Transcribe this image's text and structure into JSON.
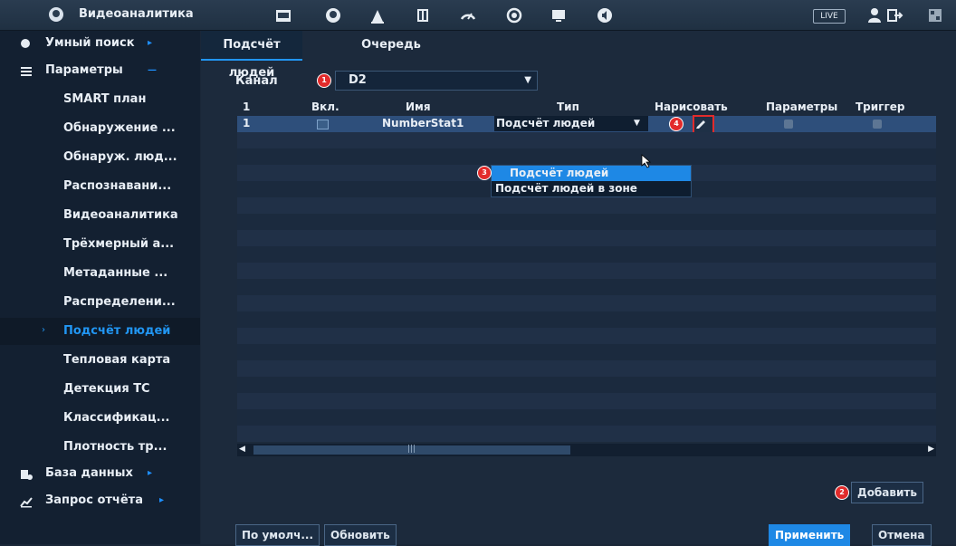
{
  "header": {
    "title": "Видеоаналитика",
    "live_label": "LIVE",
    "icons": [
      "face-icon",
      "film-icon",
      "face-icon",
      "alarm-icon",
      "storage-icon",
      "speed-icon",
      "record-icon",
      "monitor-icon",
      "audio-icon",
      "user-icon",
      "logout-icon",
      "qr-icon"
    ]
  },
  "sidebar": {
    "top": [
      {
        "label": "Умный поиск",
        "icon": "face-search-icon"
      },
      {
        "label": "Параметры",
        "icon": "list-icon"
      },
      {
        "label": "База данных",
        "icon": "database-icon"
      },
      {
        "label": "Запрос отчёта",
        "icon": "chart-icon"
      }
    ],
    "items": [
      {
        "label": "SMART план"
      },
      {
        "label": "Обнаружение ..."
      },
      {
        "label": "Обнаруж. люд..."
      },
      {
        "label": "Распознавани..."
      },
      {
        "label": "Видеоаналитика"
      },
      {
        "label": "Трёхмерный а..."
      },
      {
        "label": "Метаданные ..."
      },
      {
        "label": "Распределени..."
      },
      {
        "label": "Подсчёт людей"
      },
      {
        "label": "Тепловая карта"
      },
      {
        "label": "Детекция ТС"
      },
      {
        "label": "Классификац..."
      },
      {
        "label": "Плотность тр..."
      }
    ],
    "active_index": 8
  },
  "tabs": [
    {
      "label": "Подсчёт людей"
    },
    {
      "label": "Очередь"
    }
  ],
  "channel": {
    "label": "Канал",
    "value": "D2",
    "badge": "1"
  },
  "table": {
    "headers": {
      "num": "1",
      "enabled": "Вкл.",
      "name": "Имя",
      "type": "Тип",
      "draw": "Нарисовать",
      "params": "Параметры",
      "trigger": "Триггер"
    },
    "rows": [
      {
        "num": "1",
        "enabled": true,
        "name": "NumberStat1",
        "type": "Подсчёт людей"
      }
    ],
    "draw_badge": "4"
  },
  "dropdown": {
    "options": [
      "Подсчёт людей",
      "Подсчёт людей в зоне"
    ],
    "badge": "3"
  },
  "buttons": {
    "add": "Добавить",
    "add_badge": "2",
    "default": "По умолч...",
    "refresh": "Обновить",
    "apply": "Применить",
    "cancel": "Отмена"
  }
}
